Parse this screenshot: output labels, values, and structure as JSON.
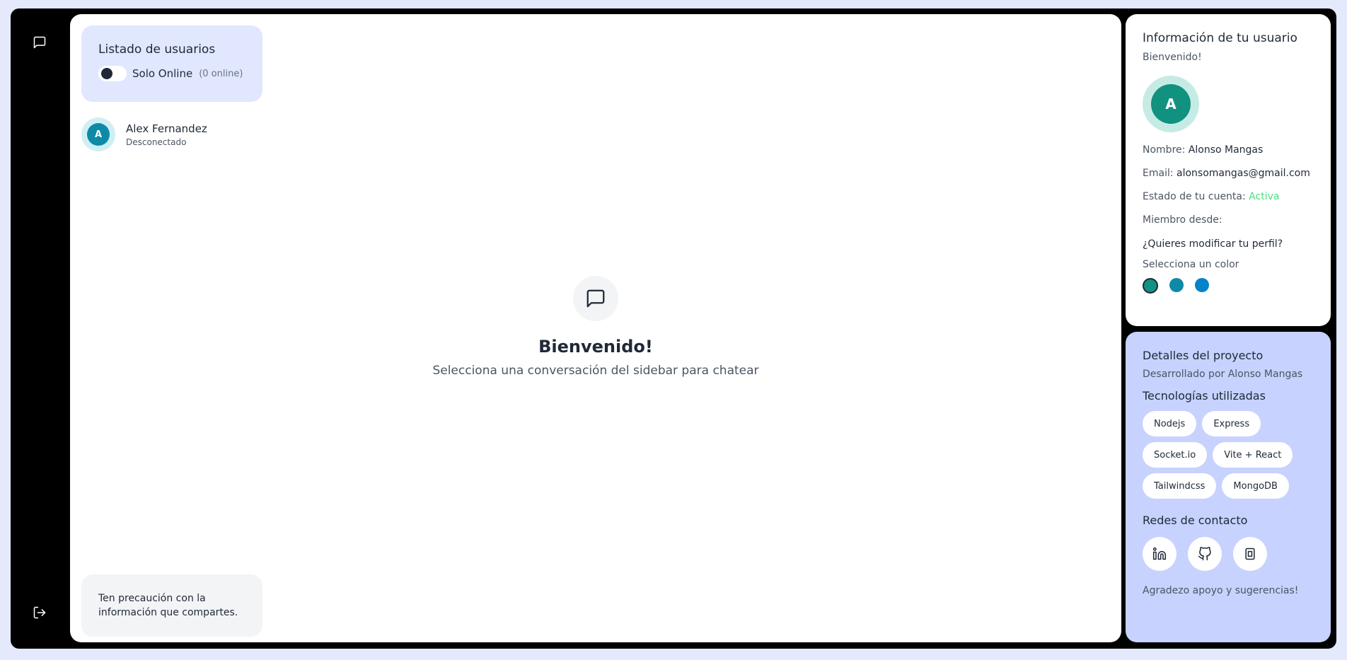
{
  "rail": {
    "chat_icon": "message-square-icon",
    "logout_icon": "logout-icon"
  },
  "sidebar": {
    "title": "Listado de usuarios",
    "toggle_label": "Solo Online",
    "online_count": "(0 online)",
    "users": [
      {
        "initial": "A",
        "name": "Alex Fernandez",
        "status": "Desconectado"
      }
    ],
    "warning": "Ten precaución con la información que compartes."
  },
  "welcome": {
    "title": "Bienvenido!",
    "subtitle": "Selecciona una conversación del sidebar para chatear"
  },
  "user_info": {
    "title": "Información de tu usuario",
    "subtitle": "Bienvenido!",
    "avatar_initial": "A",
    "name_key": "Nombre:",
    "name_value": "Alonso Mangas",
    "email_key": "Email:",
    "email_value": "alonsomangas@gmail.com",
    "status_key": "Estado de tu cuenta:",
    "status_value": "Activa",
    "member_key": "Miembro desde:",
    "modify": "¿Quieres modificar tu perfil?",
    "color_label": "Selecciona un color",
    "colors": [
      "#11917f",
      "#0e8aa8",
      "#0284c7"
    ],
    "selected_color": "#11917f"
  },
  "project": {
    "title": "Detalles del proyecto",
    "subtitle": "Desarrollado por Alonso Mangas",
    "tech_title": "Tecnologías utilizadas",
    "techs": [
      "Nodejs",
      "Express",
      "Socket.io",
      "Vite + React",
      "Tailwindcss",
      "MongoDB"
    ],
    "contact_title": "Redes de contacto",
    "socials": [
      "linkedin-icon",
      "github-icon",
      "portfolio-icon"
    ],
    "thanks": "Agradezo apoyo y sugerencias!"
  }
}
